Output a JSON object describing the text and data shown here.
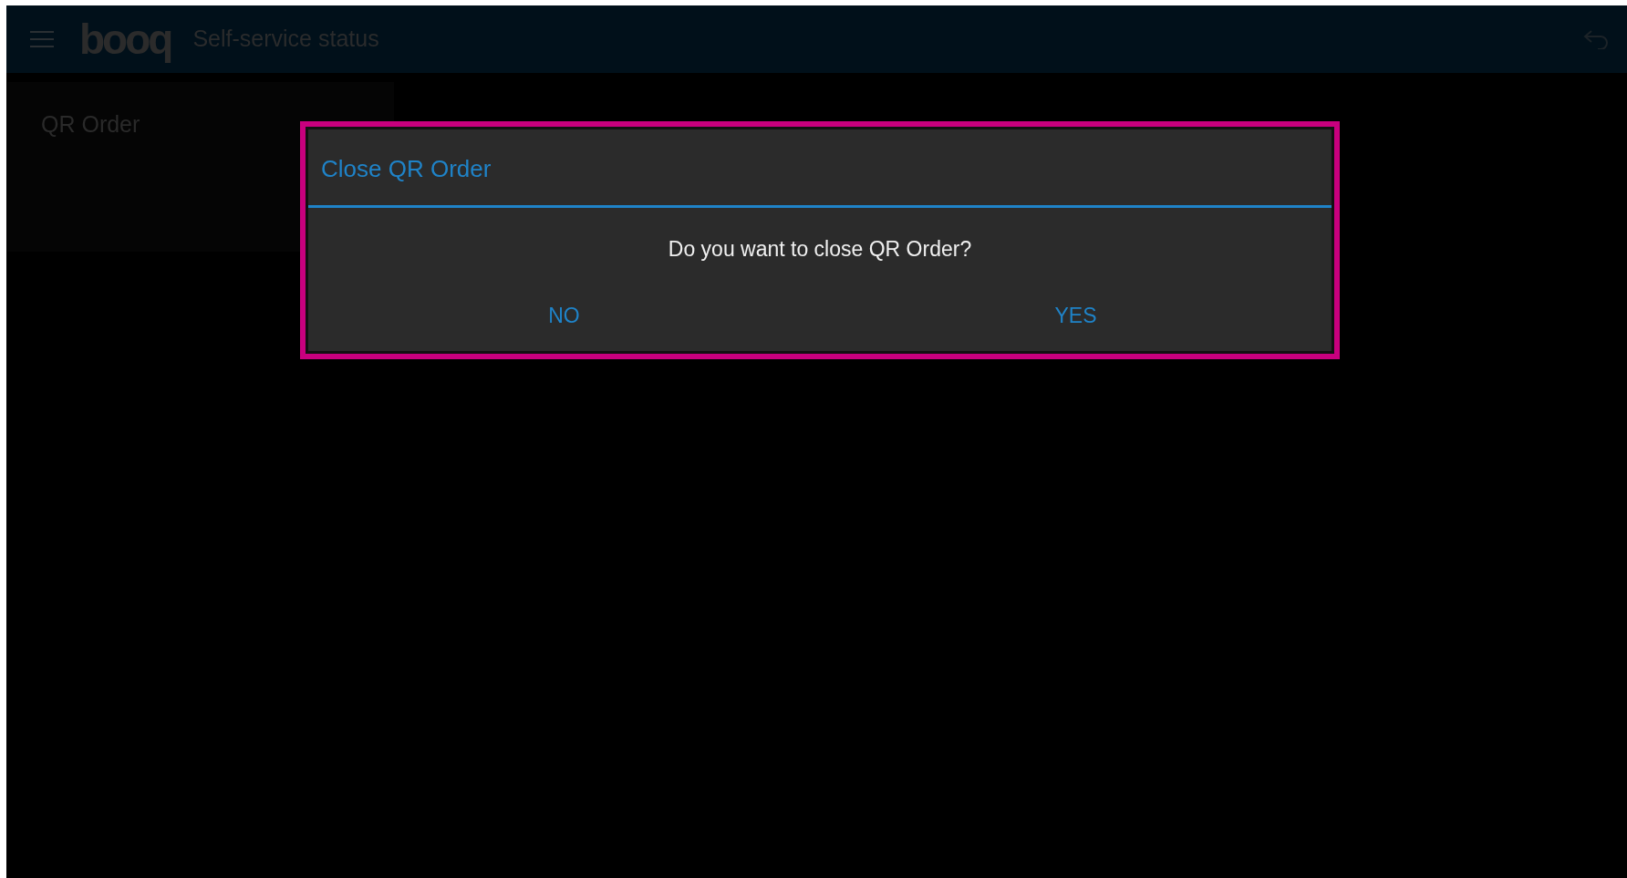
{
  "app_bar": {
    "logo": "booq",
    "title": "Self-service status"
  },
  "sidebar": {
    "items": [
      {
        "label": "QR Order"
      }
    ]
  },
  "dialog": {
    "title": "Close QR Order",
    "message": "Do you want to close QR Order?",
    "highlighted": true,
    "buttons": [
      {
        "label": "NO"
      },
      {
        "label": "YES"
      }
    ]
  }
}
